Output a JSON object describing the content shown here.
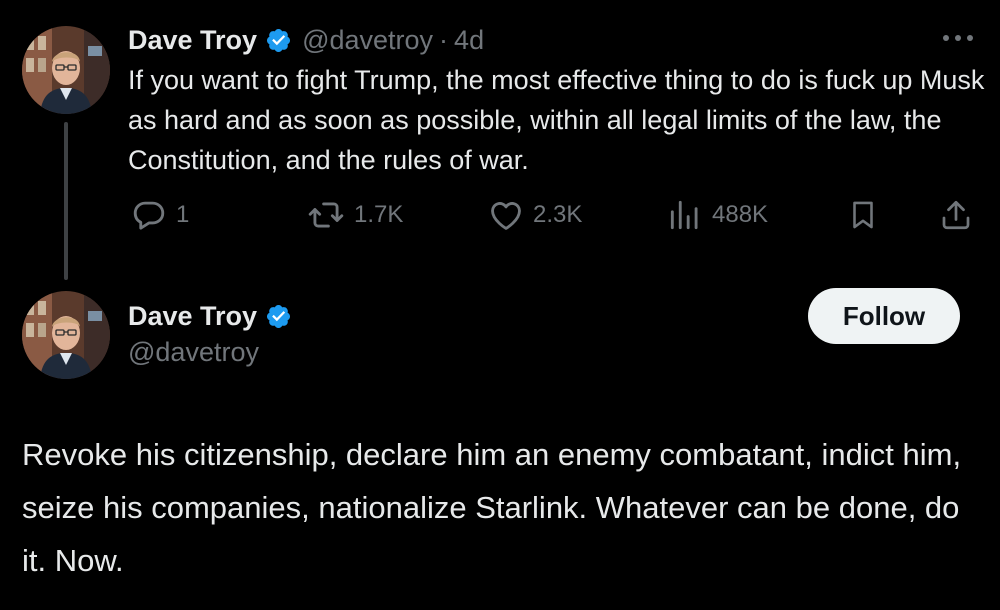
{
  "tweet1": {
    "author_name": "Dave Troy",
    "handle": "@davetroy",
    "separator": "·",
    "time": "4d",
    "verified_icon": "verified-badge-icon",
    "verified_color": "#1d9bf0",
    "text": "If you want to fight Trump, the most effective thing to do is fuck up Musk as hard and as soon as possible, within all legal limits of the law, the Constitution, and the rules of war.",
    "actions": {
      "replies": "1",
      "reposts": "1.7K",
      "likes": "2.3K",
      "views": "488K"
    }
  },
  "tweet2": {
    "author_name": "Dave Troy",
    "handle": "@davetroy",
    "follow_label": "Follow",
    "text": "Revoke his citizenship, declare him an enemy combatant, indict him, seize his companies, nationalize Starlink. Whatever can be done, do it. Now."
  },
  "colors": {
    "background": "#000000",
    "primary_text": "#e7e9ea",
    "secondary_text": "#71767b",
    "follow_button_bg": "#eff3f4",
    "thread_line": "#3e4144"
  }
}
